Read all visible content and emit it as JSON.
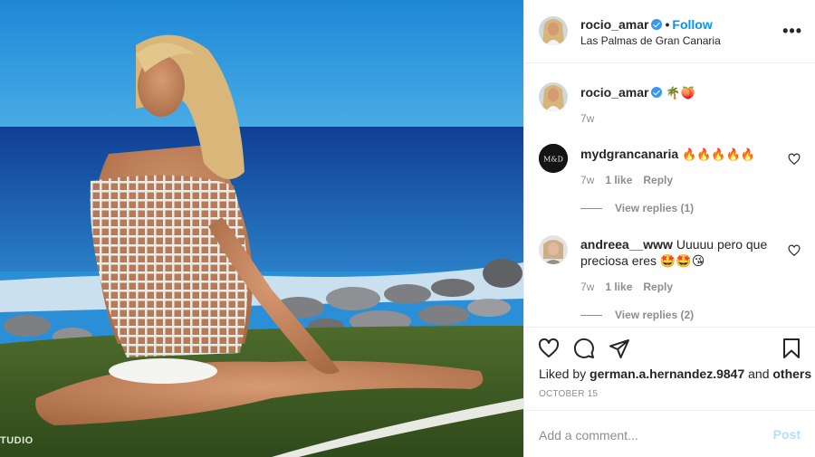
{
  "photo": {
    "watermark": "TUDIO"
  },
  "post": {
    "username": "rocio_amar",
    "follow_label": "Follow",
    "location": "Las Palmas de Gran Canaria",
    "caption": "🌴🍑",
    "caption_age": "7w"
  },
  "comments": [
    {
      "username": "mydgrancanaria",
      "avatar_text": "M&D",
      "text": "🔥🔥🔥🔥🔥",
      "age": "7w",
      "likes": "1 like",
      "reply_label": "Reply",
      "view_replies": "View replies (1)"
    },
    {
      "username": "andreea__www",
      "text": "Uuuuu pero que preciosa eres 🤩🤩😘",
      "age": "7w",
      "likes": "1 like",
      "reply_label": "Reply",
      "view_replies": "View replies (2)"
    }
  ],
  "liked_by": {
    "prefix": "Liked by",
    "user": "german.a.hernandez.9847",
    "and": "and",
    "others": "others"
  },
  "date": "OCTOBER 15",
  "add_comment": {
    "placeholder": "Add a comment...",
    "post_label": "Post"
  },
  "colors": {
    "link_blue": "#0095f6",
    "verified_blue": "#3897f0",
    "muted_text": "#8e8e8e",
    "post_disabled": "#b2dffc"
  }
}
